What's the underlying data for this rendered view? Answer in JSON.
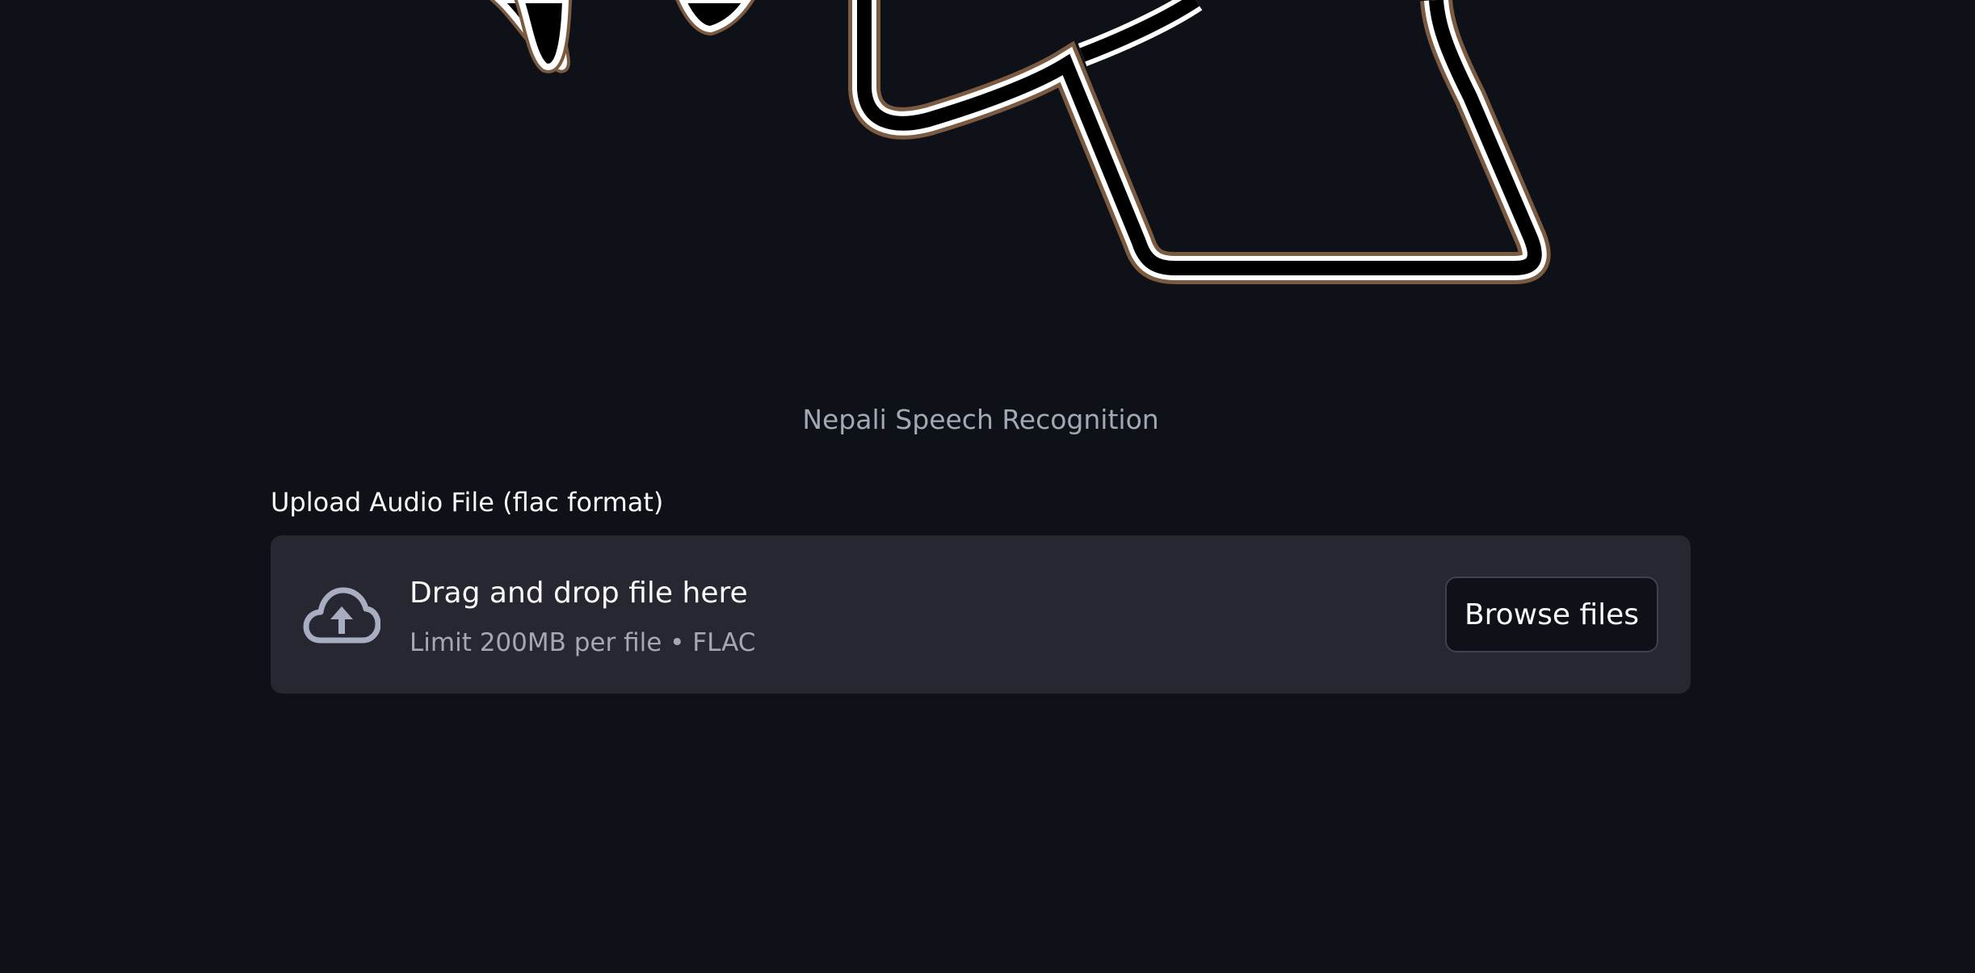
{
  "caption": "Nepali Speech Recognition",
  "uploader": {
    "label": "Upload Audio File (flac format)",
    "drop_title": "Drag and drop file here",
    "drop_limit": "Limit 200MB per file • FLAC",
    "browse_label": "Browse files",
    "icon": "cloud-upload-icon"
  },
  "colors": {
    "background": "#0e1117",
    "dropzone": "#262730",
    "text": "#fafafa",
    "muted": "#a3a8b4"
  }
}
